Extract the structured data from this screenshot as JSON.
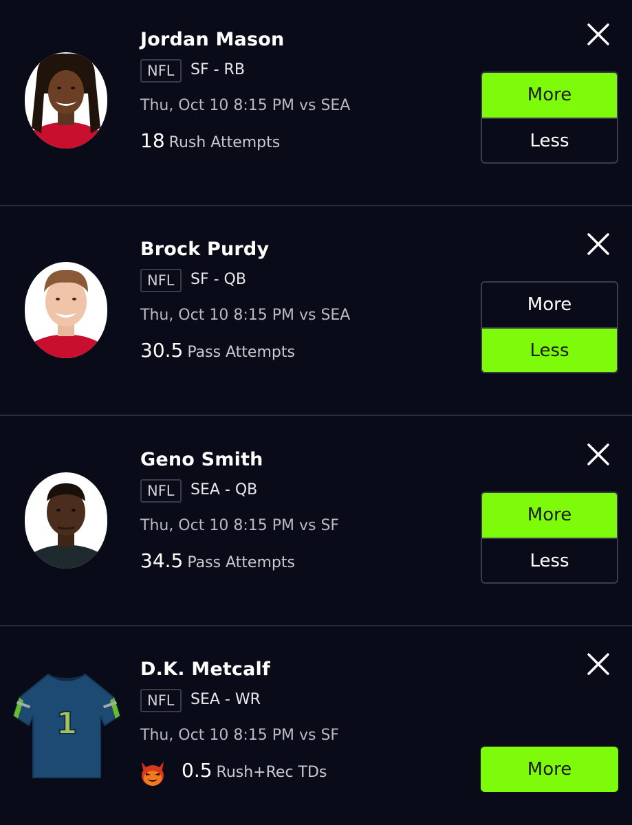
{
  "picks": [
    {
      "name": "Jordan Mason",
      "league": "NFL",
      "team_pos": "SF - RB",
      "game": "Thu, Oct 10 8:15 PM vs SEA",
      "line_value": "18",
      "stat": "Rush Attempts",
      "more_label": "More",
      "less_label": "Less",
      "selected": "More"
    },
    {
      "name": "Brock Purdy",
      "league": "NFL",
      "team_pos": "SF - QB",
      "game": "Thu, Oct 10 8:15 PM vs SEA",
      "line_value": "30.5",
      "stat": "Pass Attempts",
      "more_label": "More",
      "less_label": "Less",
      "selected": "Less"
    },
    {
      "name": "Geno Smith",
      "league": "NFL",
      "team_pos": "SEA - QB",
      "game": "Thu, Oct 10 8:15 PM vs SF",
      "line_value": "34.5",
      "stat": "Pass Attempts",
      "more_label": "More",
      "less_label": "Less",
      "selected": "More"
    },
    {
      "name": "D.K. Metcalf",
      "league": "NFL",
      "team_pos": "SEA - WR",
      "game": "Thu, Oct 10 8:15 PM vs SF",
      "line_value": "0.5",
      "stat": "Rush+Rec TDs",
      "more_label": "More",
      "selected": "More",
      "jersey_number": "1",
      "badge_icon": "demon-icon"
    }
  ],
  "icons": {
    "close": "close-icon"
  },
  "colors": {
    "background": "#0a0b18",
    "accent": "#7dfb0a",
    "divider": "#2a2c38"
  }
}
